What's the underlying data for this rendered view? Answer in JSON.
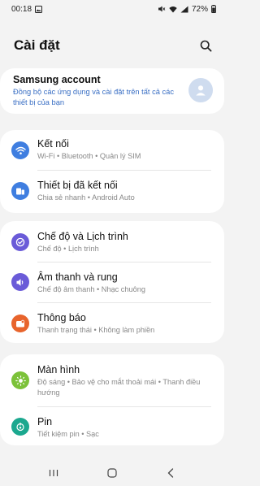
{
  "status": {
    "time": "00:18",
    "battery": "72%"
  },
  "header": {
    "title": "Cài đặt"
  },
  "account": {
    "title": "Samsung account",
    "description": "Đồng bộ các ứng dụng và cài đặt trên tất cả các thiết bị của bạn"
  },
  "groups": {
    "connections": {
      "title": "Kết nối",
      "subtitle": "Wi-Fi  •  Bluetooth  •  Quản lý SIM"
    },
    "connected_devices": {
      "title": "Thiết bị đã kết nối",
      "subtitle": "Chia sẻ nhanh  •  Android Auto"
    },
    "modes": {
      "title": "Chế độ và Lịch trình",
      "subtitle": "Chế độ  •  Lịch trình"
    },
    "sound": {
      "title": "Âm thanh và rung",
      "subtitle": "Chế độ âm thanh  •  Nhạc chuông"
    },
    "notifications": {
      "title": "Thông báo",
      "subtitle": "Thanh trạng thái  •  Không làm phiền"
    },
    "display": {
      "title": "Màn hình",
      "subtitle": "Độ sáng  •  Bảo vệ cho mắt thoải mái  •  Thanh điều hướng"
    },
    "battery": {
      "title": "Pin",
      "subtitle": "Tiết kiệm pin  •  Sạc"
    }
  },
  "icon_colors": {
    "connections": "#3f7ee0",
    "connected_devices": "#3f7ee0",
    "modes": "#6a5bd8",
    "sound": "#6a5bd8",
    "notifications": "#e8642c",
    "display": "#7cc23a",
    "battery": "#1ba88f"
  }
}
